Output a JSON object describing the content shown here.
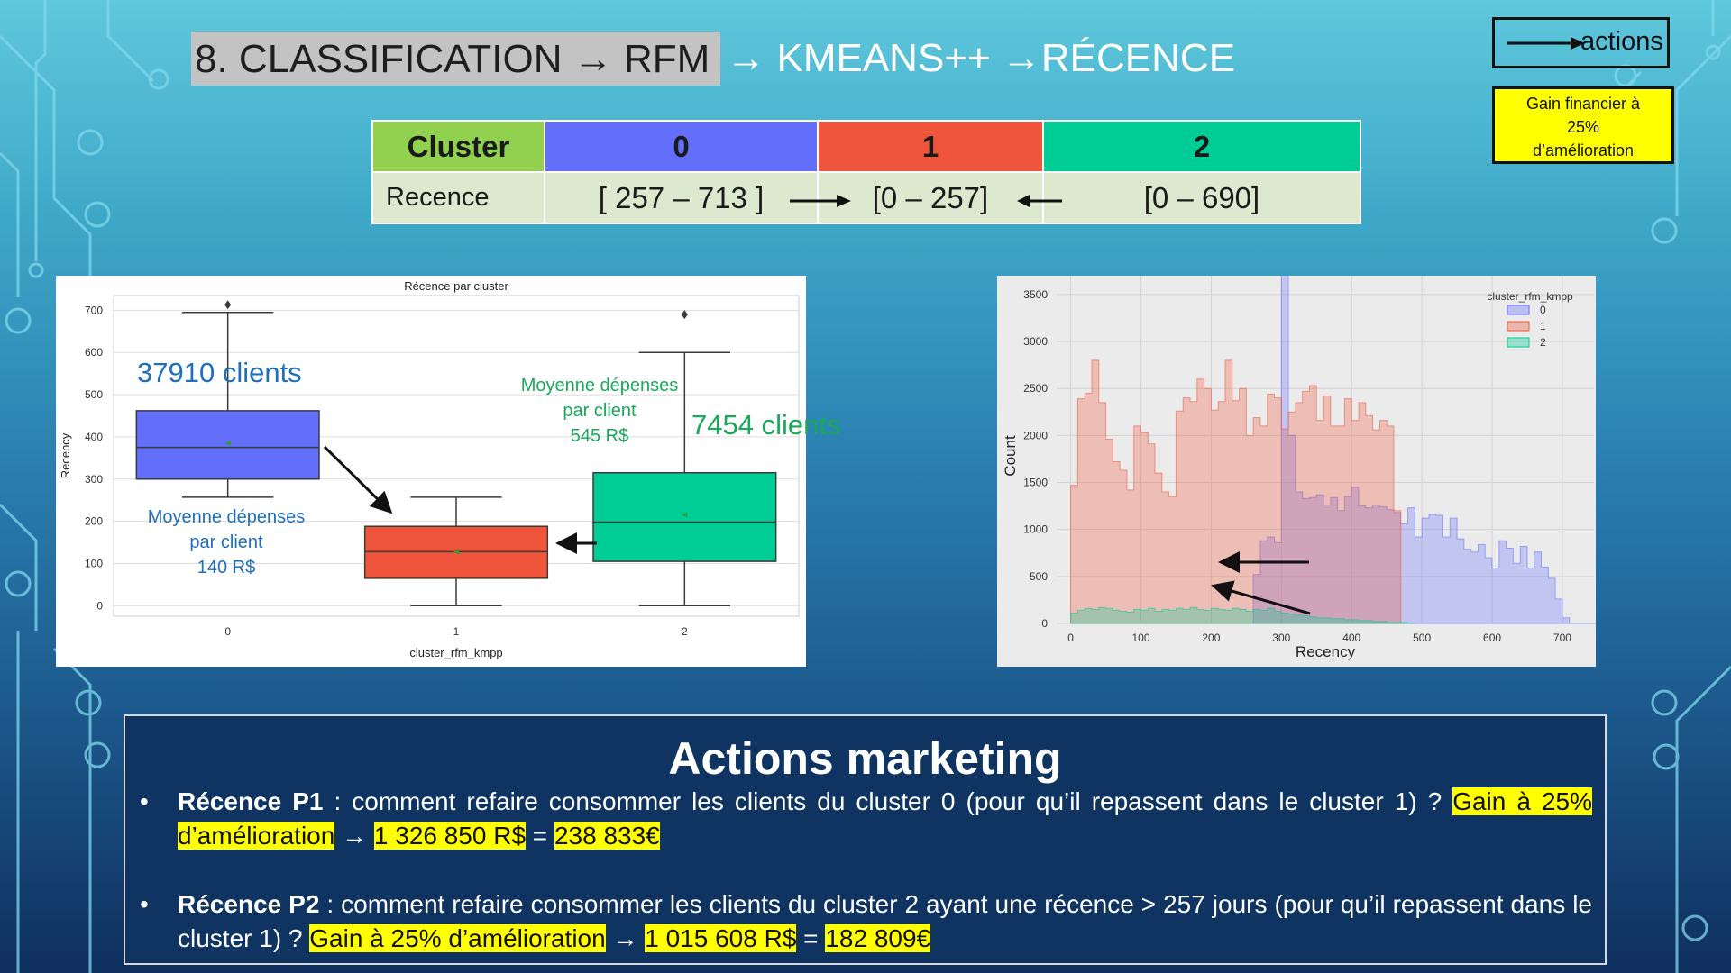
{
  "title": {
    "part1": "8. CLASSIFICATION → RFM",
    "part2": "→ KMEANS++ →RÉCENCE"
  },
  "legend": {
    "label": "actions"
  },
  "gain_box": {
    "line1": "Gain financier à",
    "line2": "25%",
    "line3": "d’amélioration"
  },
  "table": {
    "header": [
      "Cluster",
      "0",
      "1",
      "2"
    ],
    "row": [
      "Recence",
      "[ 257 – 713 ]",
      "[0 – 257]",
      "[0 – 690]"
    ],
    "header_colors": [
      "#92d050",
      "#636efa",
      "#ef553b",
      "#00cc96"
    ]
  },
  "left_annotations": {
    "c0_clients": "37910 clients",
    "c0_spend": [
      "Moyenne dépenses",
      "par client",
      "140 R$"
    ],
    "c2_spend": [
      "Moyenne dépenses",
      "par client",
      "545 R$"
    ],
    "c2_clients": "7454 clients",
    "blue": "#1f6fbf",
    "green": "#1aa85a"
  },
  "chart_data": [
    {
      "type": "box",
      "title": "Récence par cluster",
      "xlabel": "cluster_rfm_kmpp",
      "ylabel": "Recency",
      "categories": [
        "0",
        "1",
        "2"
      ],
      "ylim": [
        -25,
        735
      ],
      "yticks": [
        0,
        100,
        200,
        300,
        400,
        500,
        600,
        700
      ],
      "boxes": [
        {
          "category": "0",
          "min": 257,
          "q1": 300,
          "median": 375,
          "q3": 462,
          "max": 695,
          "mean": 385,
          "outliers": [
            713
          ],
          "color": "#636efa"
        },
        {
          "category": "1",
          "min": 0,
          "q1": 65,
          "median": 128,
          "q3": 188,
          "max": 257,
          "mean": 128,
          "outliers": [],
          "color": "#ef553b"
        },
        {
          "category": "2",
          "min": 0,
          "q1": 105,
          "median": 198,
          "q3": 315,
          "max": 600,
          "mean": 215,
          "outliers": [
            690
          ],
          "color": "#00cc96"
        }
      ],
      "grid": true
    },
    {
      "type": "histogram",
      "xlabel": "Recency",
      "ylabel": "Count",
      "xlim": [
        -20,
        745
      ],
      "ylim": [
        0,
        3700
      ],
      "xticks": [
        0,
        100,
        200,
        300,
        400,
        500,
        600,
        700
      ],
      "yticks": [
        0,
        500,
        1000,
        1500,
        2000,
        2500,
        3000,
        3500
      ],
      "legend_title": "cluster_rfm_kmpp",
      "legend_position": "top-right",
      "bin_width": 10,
      "series": [
        {
          "name": "0",
          "color": "#636efa",
          "start": 260,
          "values": [
            520,
            880,
            920,
            860,
            3720,
            2000,
            1400,
            1330,
            1340,
            1370,
            1260,
            1340,
            1200,
            1350,
            1450,
            1250,
            1230,
            1260,
            1240,
            1210,
            1180,
            1060,
            1230,
            920,
            1120,
            1160,
            1150,
            920,
            1120,
            900,
            790,
            760,
            840,
            700,
            590,
            880,
            800,
            640,
            820,
            590,
            760,
            600,
            480,
            260,
            60,
            0,
            0,
            0,
            0,
            0,
            0,
            0,
            0,
            0,
            0,
            0,
            0,
            0,
            0,
            0,
            0,
            0,
            0,
            0,
            0,
            0,
            180,
            100
          ]
        },
        {
          "name": "1",
          "color": "#ef553b",
          "start": 0,
          "values": [
            1470,
            2390,
            2450,
            2800,
            2350,
            1960,
            1720,
            1630,
            1420,
            2100,
            2030,
            1910,
            1600,
            1400,
            1350,
            2260,
            2400,
            2360,
            2600,
            2500,
            2270,
            2360,
            2800,
            2370,
            2500,
            2000,
            2190,
            2100,
            2440,
            2400,
            2070,
            2250,
            2350,
            2470,
            2530,
            2160,
            2420,
            2100,
            2100,
            2390,
            2160,
            2350,
            2210,
            2060,
            2160,
            2100,
            1200,
            0
          ]
        },
        {
          "name": "2",
          "color": "#00cc96",
          "start": 0,
          "values": [
            110,
            140,
            160,
            150,
            170,
            160,
            140,
            130,
            120,
            150,
            140,
            160,
            130,
            150,
            140,
            160,
            150,
            170,
            150,
            140,
            160,
            150,
            140,
            160,
            150,
            130,
            150,
            140,
            160,
            130,
            110,
            100,
            90,
            80,
            70,
            60,
            60,
            50,
            50,
            40,
            40,
            30,
            30,
            20,
            20,
            10,
            10,
            10,
            0
          ]
        }
      ]
    }
  ],
  "actions": {
    "title": "Actions marketing",
    "p1": {
      "bullet": "•",
      "label": "Récence P1",
      "text": " : comment refaire consommer les clients du cluster 0 (pour qu’il repassent dans le cluster 1) ? ",
      "hl1": "Gain à 25% d’amélioration",
      "arrow": " → ",
      "hl2": "1 326 850 R$",
      "eq": " = ",
      "hl3": "238 833€"
    },
    "p2": {
      "bullet": "•",
      "label": "Récence P2",
      "text": " : comment refaire consommer les clients du cluster 2 ayant une récence > 257 jours (pour qu’il repassent dans le cluster 1) ? ",
      "hl1": "Gain à 25% d’amélioration",
      "arrow": " → ",
      "hl2": "1 015 608 R$",
      "eq": " = ",
      "hl3": "182 809€"
    }
  }
}
